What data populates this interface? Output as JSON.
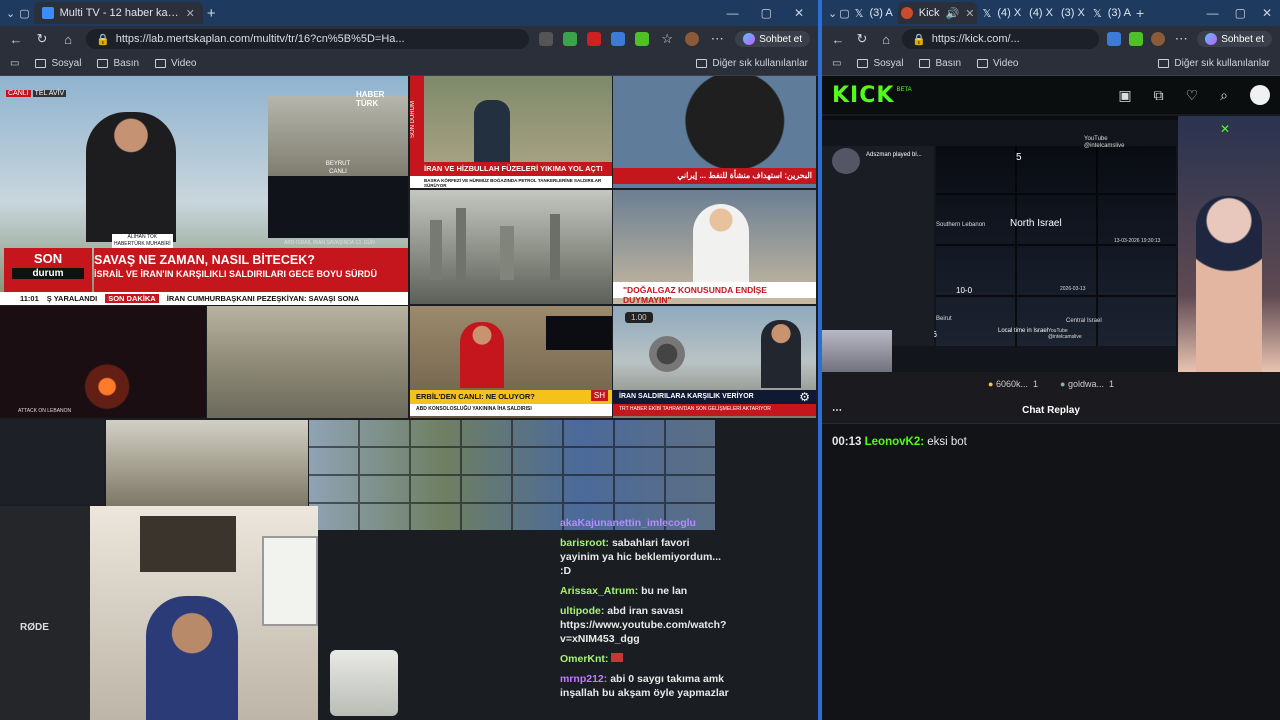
{
  "left_window": {
    "tab_title": "Multi TV - 12 haber kanalını aynı a",
    "url": "https://lab.mertskaplan.com/multitv/tr/16?cn%5B%5D=Ha...",
    "sync_label": "Sohbet et",
    "bookmarks": [
      "Sosyal",
      "Basın",
      "Video"
    ],
    "other_bookmarks": "Diğer sık kullanılanlar",
    "tiles": {
      "t1_live_tag": "CANLI",
      "t1_city": "TEL AVİV",
      "t1_channel": "HABER TÜRK",
      "t1_reporter": "ALİHAN TOK",
      "t1_reporter_role": "HABERTÜRK MUHABİRİ",
      "t1_beirut": "BEYRUT",
      "t1_beirut_sub": "CANLI",
      "t1_top_strip": "ABD-İSRAİL İRAN SAVAŞINDA 13. GÜN",
      "t1_logo_top": "SON",
      "t1_logo_bottom": "durum",
      "t1_headline": "SAVAŞ NE ZAMAN, NASIL BİTECEK?",
      "t1_sub": "İSRAİL VE İRAN'IN KARŞILIKLI SALDIRILARI GECE BOYU SÜRDÜ",
      "t1_time": "11:01",
      "t1_ticker_a": "Ş YARALANDI",
      "t1_ticker_tag": "SON DAKİKA",
      "t1_ticker_b": "İRAN CUMHURBAŞKANI PEZEŞKİYAN: SAVAŞI SONA",
      "t2_side": "SON DURUM",
      "t2_headline": "İRAN VE HİZBULLAH FÜZELERİ YIKIMA YOL AÇTI",
      "t2_sub": "BASRA KÖRFEZİ VE HÜRMÜZ BOĞAZINDA PETROL TANKERLERİNE SALDIRILAR SÜRÜYOR",
      "t3_ar": "البحرين: استهداف منشأة للنفط ... إيراني",
      "t4_headline": "\"DOĞALGAZ KONUSUNDA ENDİŞE DUYMAYIN\"",
      "t5_headline": "ERBİL'DEN CANLI: NE OLUYOR?",
      "t5_sub": "ABD KONSOLOSLUĞU YAKININA İHA SALDIRISI",
      "t5_badge": "SH",
      "t6_pill": "1.00",
      "t6_headline": "İRAN SALDIRILARA KARŞILIK VERİYOR",
      "t6_sub": "TRT HABER EKİBİ TAHRAN'DAN SON GELİŞMELERİ AKTARIYOR",
      "t7_caption": "ATTACK ON LEBANON"
    },
    "chat": [
      {
        "user": "akaKajunanettin_imlecoglu",
        "text": "",
        "color": "#b38cff"
      },
      {
        "user": "barisroot:",
        "text": "sabahlari favori yayinim ya hic beklemiyordum... :D",
        "color": "#a7f36b"
      },
      {
        "user": "Arissax_Atrum:",
        "text": "bu ne lan",
        "color": "#a7f36b"
      },
      {
        "user": "ultipode:",
        "text": "abd iran savası https://www.youtube.com/watch?v=xNIM453_dgg",
        "color": "#a7f36b"
      },
      {
        "user": "OmerKnt:",
        "text": "",
        "color": "#a7f36b"
      },
      {
        "user": "mrnp212:",
        "text": "abi 0 saygı takıma amk inşallah bu akşam öyle yapmazlar",
        "color": "#c27bff"
      }
    ],
    "mic_label": "RØDE"
  },
  "right_window": {
    "tabs": [
      "(3) A",
      "Kick",
      "(4) X",
      "(4) X",
      "(3) X",
      "(3) A"
    ],
    "url": "https://kick.com/...",
    "sync_label": "Sohbet et",
    "bookmarks": [
      "Sosyal",
      "Basın",
      "Video"
    ],
    "other_bookmarks": "Diğer sık kullanılanlar",
    "kick_logo": "KICK",
    "kick_beta": "BETA",
    "player_labels": {
      "north_israel": "North Israel",
      "southern_lebanon": "Southern Lebanon",
      "central_israel": "Central Israel",
      "beirut": "Beirut",
      "local_time": "Local time in Israel",
      "played": "Adszman played bl...",
      "yt": "YouTube",
      "yt_handle": "@intelcamslive",
      "cam_num": "5",
      "date1": "13-03-2026 19:30:13",
      "date2": "2026-03-13",
      "counter_a": "10-0",
      "counter_b": "26"
    },
    "viewer_stats": [
      {
        "label": "6060k...",
        "value": "1"
      },
      {
        "label": "goldwa...",
        "value": "1"
      }
    ],
    "chat_title": "Chat Replay",
    "chat_menu": "⋯",
    "chat_replay": [
      {
        "time": "00:13",
        "user": "LeonovK2:",
        "text": "eksi bot"
      }
    ]
  }
}
